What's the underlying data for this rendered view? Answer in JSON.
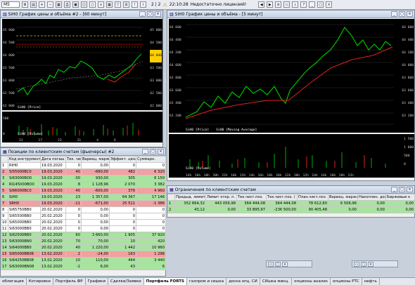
{
  "toolbar": {
    "timeframe": "M5",
    "layout_id": "2 | 2",
    "time": "22:10:28",
    "status": "Недостаточно лицензий!"
  },
  "chart1": {
    "title": "SiH0 График цены и объёма #2 - [60 минут]",
    "y_ticks": [
      "65 000",
      "64 500",
      "64 000",
      "63 500",
      "63 000",
      "62 500",
      "62 000"
    ],
    "y_ticks_right": [
      "65 000",
      "64 500",
      "64 046",
      "63 500",
      "63 000",
      "62 500",
      "62 000"
    ],
    "legend": "SiH0 [Price]",
    "vol_legend": "SiH0 [Volume]",
    "vol_ticks": [
      "500",
      "0"
    ],
    "x_labels": [
      "13",
      "17",
      "23",
      "31",
      "4",
      "6"
    ]
  },
  "chart2": {
    "title": "SiH0 График цены и объёма - [5 минут]",
    "y_ticks": [
      "64 600",
      "64 400",
      "64 200",
      "64 000",
      "63 800",
      "63 600",
      "63 400",
      "63 200",
      "63 000"
    ],
    "legend_price": "SiH0 [Price]",
    "legend_ma": "SiH0 [Moving Average]",
    "vol_legend": "SiH0 [Volume]",
    "vol_ticks": [
      "1 500",
      "1 000",
      "500",
      "0"
    ],
    "x_labels": [
      "14h",
      "16h",
      "18h",
      "20h",
      "22h",
      "10h",
      "12h",
      "14h",
      "16h",
      "18h",
      "20h",
      "22h",
      "10h",
      "12h",
      "14h",
      "16h",
      "18h",
      "20h",
      "22h"
    ]
  },
  "positions": {
    "title": "Позиции по клиентским счетам (фьючерсы) #2",
    "headers": [
      "",
      "Код инструмента",
      "Дата погаш",
      "Тек. чист.",
      "Вариац. маржа",
      "Эффект. цена",
      "Суммарн."
    ],
    "rows": [
      {
        "n": "1",
        "code": "RIH0",
        "date": "19.03.2020",
        "pos": "0",
        "vm": "0,00",
        "eff": "0",
        "sum": "0",
        "style": "w"
      },
      {
        "n": "2",
        "code": "Si55000BC0",
        "date": "19.03.2020",
        "pos": "40",
        "vm": "-680,00",
        "eff": "482",
        "sum": "6 320",
        "style": "r"
      },
      {
        "n": "3",
        "code": "Si63000BO0",
        "date": "19.03.2020",
        "pos": "-30",
        "vm": "930,00",
        "eff": "305",
        "sum": "6 150",
        "style": "g"
      },
      {
        "n": "4",
        "code": "RI145000BO0",
        "date": "19.03.2020",
        "pos": "8",
        "vm": "1 128,96",
        "eff": "2 070",
        "sum": "3 382",
        "style": "g"
      },
      {
        "n": "5",
        "code": "Si66000BC0",
        "date": "19.03.2020",
        "pos": "40",
        "vm": "-600,00",
        "eff": "376",
        "sum": "4 960",
        "style": "r"
      },
      {
        "n": "6",
        "code": "SiH0",
        "date": "19.03.2020",
        "pos": "23",
        "vm": "1 357,00",
        "eff": "64 367",
        "sum": "17 146",
        "style": "g"
      },
      {
        "n": "7",
        "code": "SRH0",
        "date": "19.03.2020",
        "pos": "-11",
        "vm": "-671,00",
        "eff": "25 511",
        "sum": "-1 386",
        "style": "r"
      },
      {
        "n": "8",
        "code": "Si65750BB0",
        "date": "20.02.2020",
        "pos": "0",
        "vm": "0,00",
        "eff": "0",
        "sum": "0",
        "style": "w"
      },
      {
        "n": "9",
        "code": "Si65500BB0",
        "date": "20.02.2020",
        "pos": "0",
        "vm": "0,00",
        "eff": "0",
        "sum": "0",
        "style": "w"
      },
      {
        "n": "10",
        "code": "Si65000BB0",
        "date": "20.02.2020",
        "pos": "0",
        "vm": "0,00",
        "eff": "0",
        "sum": "0",
        "style": "w"
      },
      {
        "n": "11",
        "code": "Si63000BB0",
        "date": "20.02.2020",
        "pos": "0",
        "vm": "0,00",
        "eff": "0",
        "sum": "0",
        "style": "w"
      },
      {
        "n": "12",
        "code": "Si62500BB0",
        "date": "20.02.2020",
        "pos": "60",
        "vm": "3 660,00",
        "eff": "1 905",
        "sum": "37 920",
        "style": "g"
      },
      {
        "n": "13",
        "code": "Si63000BN0",
        "date": "20.02.2020",
        "pos": "70",
        "vm": "70,00",
        "eff": "10",
        "sum": "420",
        "style": "g"
      },
      {
        "n": "14",
        "code": "Si64000BB0",
        "date": "20.02.2020",
        "pos": "40",
        "vm": "1 220,00",
        "eff": "1 442",
        "sum": "10 960",
        "style": "g"
      },
      {
        "n": "15",
        "code": "Si65000BB08",
        "date": "13.02.2020",
        "pos": "2",
        "vm": "-24,00",
        "eff": "163",
        "sum": "1 296",
        "style": "r"
      },
      {
        "n": "16",
        "code": "Si64250BB08",
        "date": "13.02.2020",
        "pos": "10",
        "vm": "110,00",
        "eff": "444",
        "sum": "3 440",
        "style": "g"
      },
      {
        "n": "17",
        "code": "Si63000BN08",
        "date": "13.02.2020",
        "pos": "-1",
        "vm": "6,00",
        "eff": "43",
        "sum": "6",
        "style": "g"
      }
    ]
  },
  "limits": {
    "title": "Ограничения по клиентским счетам",
    "headers": [
      "",
      "Предыд. лимит",
      "Лимит откр. п.",
      "Тек.чист.поз.",
      "Тек.чист.поз. (",
      "План.чист.поз.",
      "Вариац. маржа",
      "Накоплен. доход",
      "Биржевые к"
    ],
    "rows": [
      {
        "n": "1",
        "a": "352 664,32",
        "b": "443 056,98",
        "c": "364 444,08",
        "d": "364 444,08",
        "e": "78 612,60",
        "f": "6 506,96",
        "g": "0,00",
        "h": "0,00",
        "style": "g"
      },
      {
        "n": "2",
        "a": "43,12",
        "b": "0,00",
        "c": "33 895,97",
        "d": "-236 500,00",
        "e": "90 405,48",
        "f": "0,00",
        "g": "0,00",
        "h": "0,00",
        "style": "g"
      }
    ]
  },
  "tabs": [
    "облигация",
    "Котировки",
    "Портфель ФР",
    "Графики",
    "Сделки/Заявки",
    "Портфель FORTS",
    "газпром и сишка",
    "доска опц. СИ",
    "СИшка минц.",
    "опционы анализ",
    "опционы РТС",
    "нефть"
  ],
  "active_tab": 5,
  "colors": {
    "green_row": "#a8e4a0",
    "red_row": "#f3a0a0",
    "price_line": "#00c000",
    "ma_line": "#ff2020"
  }
}
